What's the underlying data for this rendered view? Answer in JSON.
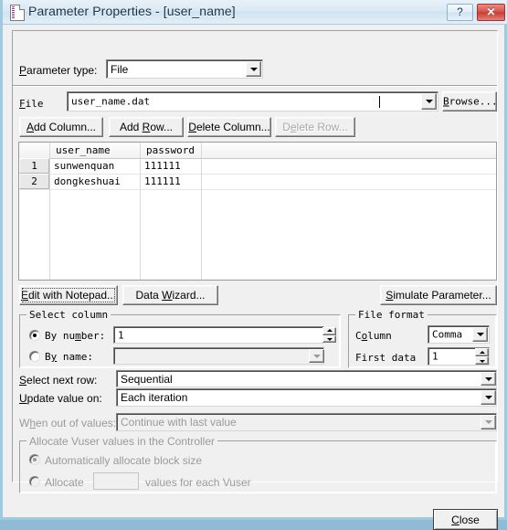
{
  "window": {
    "title": "Parameter Properties - [user_name]",
    "icon": "file-document-icon",
    "help_label": "?",
    "close_label": "✕",
    "frame_color": "#9fcbe0",
    "face_color": "#f0f0f0"
  },
  "parameter_type": {
    "label": "Parameter type:",
    "value": "File"
  },
  "file_row": {
    "label": "File",
    "value": "user_name.dat",
    "browse_label": "Browse..."
  },
  "grid_buttons": {
    "add_column": "Add Column...",
    "add_row": "Add Row...",
    "delete_column": "Delete Column...",
    "delete_row": "Delete Row...",
    "delete_row_enabled": false
  },
  "grid": {
    "columns": [
      "user_name",
      "password"
    ],
    "rows": [
      {
        "num": "1",
        "user_name": "sunwenquan",
        "password": "111111"
      },
      {
        "num": "2",
        "user_name": "dongkeshuai",
        "password": "111111"
      }
    ]
  },
  "action_buttons": {
    "edit_with_notepad": "Edit with Notepad...",
    "data_wizard": "Data Wizard...",
    "simulate_parameter": "Simulate Parameter..."
  },
  "select_column": {
    "title": "Select column",
    "by_number_label": "By number:",
    "by_number_value": "1",
    "by_number_selected": true,
    "by_name_label": "By name:",
    "by_name_value": "",
    "by_name_selected": false
  },
  "file_format": {
    "title": "File format",
    "column_label": "Column",
    "column_value": "Comma",
    "first_data_label": "First data",
    "first_data_value": "1"
  },
  "rows_settings": {
    "select_next_row_label": "Select next row:",
    "select_next_row_value": "Sequential",
    "update_value_on_label": "Update value on:",
    "update_value_on_value": "Each iteration",
    "when_out_of_values_label": "When out of values:",
    "when_out_of_values_value": "Continue with last value",
    "when_out_of_values_enabled": false
  },
  "allocate_group": {
    "title": "Allocate Vuser values in the Controller",
    "enabled": false,
    "auto_label": "Automatically allocate block size",
    "auto_selected": true,
    "allocate_label": "Allocate",
    "allocate_value": "",
    "allocate_suffix": "values for each Vuser",
    "allocate_selected": false
  },
  "footer": {
    "close_label": "Close"
  }
}
